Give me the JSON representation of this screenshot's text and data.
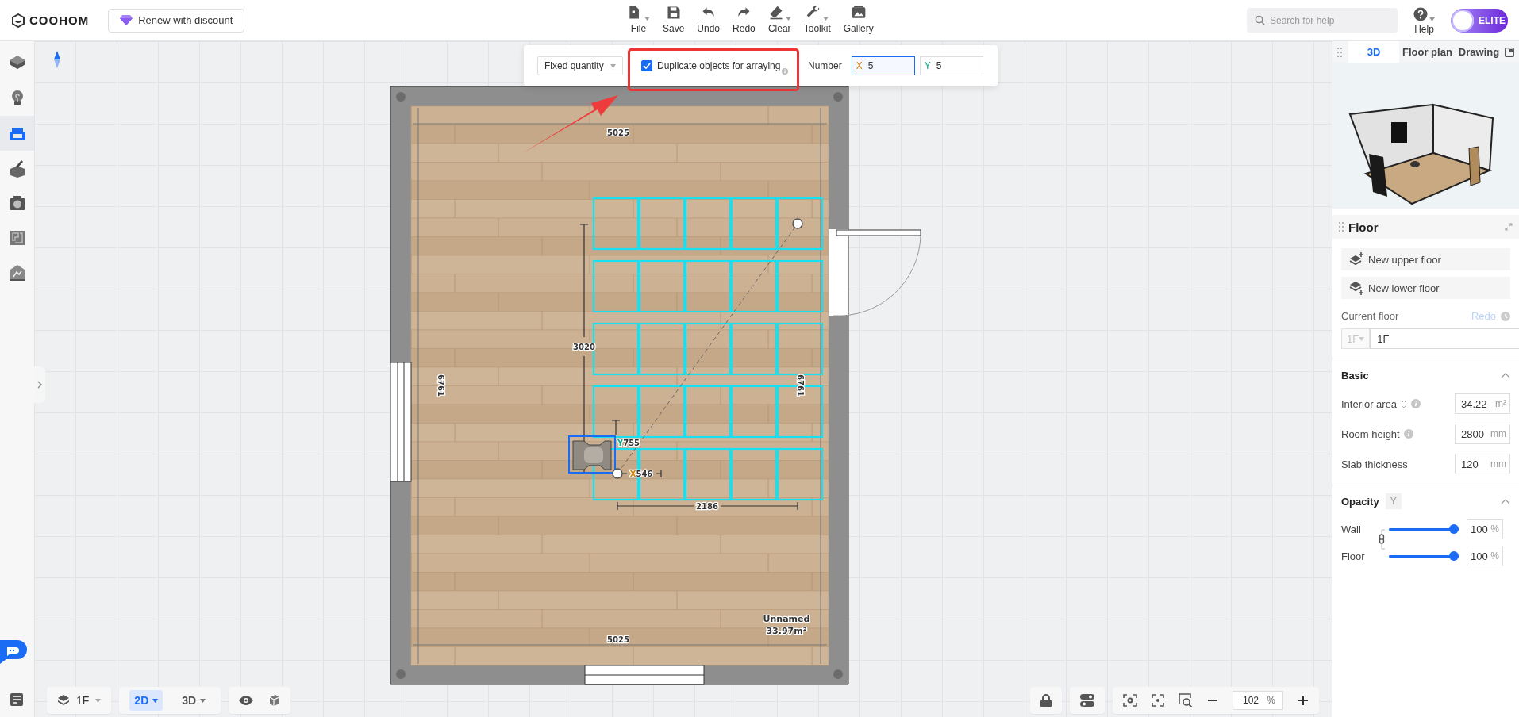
{
  "header": {
    "logo": "COOHOM",
    "promo": "Renew with discount",
    "tools": [
      {
        "kind": "file",
        "label": "File",
        "menu": true
      },
      {
        "kind": "save",
        "label": "Save",
        "menu": false
      },
      {
        "kind": "undo",
        "label": "Undo",
        "menu": false
      },
      {
        "kind": "redo",
        "label": "Redo",
        "menu": false
      },
      {
        "kind": "clear",
        "label": "Clear",
        "menu": true
      },
      {
        "kind": "toolkit",
        "label": "Toolkit",
        "menu": true
      },
      {
        "kind": "gallery",
        "label": "Gallery",
        "menu": false
      }
    ],
    "search": {
      "placeholder": "Search for help"
    },
    "help": {
      "label": "Help",
      "menu": true
    },
    "plan_badge": "ELITE"
  },
  "sidebar": {
    "items": [
      {
        "kind": "build",
        "selected": false
      },
      {
        "kind": "light",
        "selected": false
      },
      {
        "kind": "furniture",
        "selected": true
      },
      {
        "kind": "customize",
        "selected": false
      },
      {
        "kind": "render",
        "selected": false
      },
      {
        "kind": "layout",
        "selected": false
      },
      {
        "kind": "ai",
        "selected": false
      }
    ]
  },
  "array_toolbar": {
    "mode": "Fixed quantity",
    "duplicate": {
      "label": "Duplicate objects for arraying",
      "checked": true
    },
    "number_label": "Number",
    "x": {
      "axis": "X",
      "value": "5",
      "focused": true
    },
    "y": {
      "axis": "Y",
      "value": "5",
      "focused": false
    }
  },
  "plan": {
    "labels": [
      {
        "kind": "wall_top",
        "text": "5025"
      },
      {
        "kind": "wall_bottom",
        "text": "5025"
      },
      {
        "kind": "wall_left",
        "text": "6761"
      },
      {
        "kind": "wall_right",
        "text": "6761"
      },
      {
        "kind": "height",
        "text": "3020"
      },
      {
        "kind": "offset_x",
        "axis": "X",
        "text": "546"
      },
      {
        "kind": "offset_y",
        "axis": "Y",
        "text": "755"
      },
      {
        "kind": "span",
        "text": "2186"
      }
    ],
    "room": {
      "name": "Unnamed",
      "area": "33.97m²"
    }
  },
  "bottom_bar": {
    "floor": "1F",
    "view_modes": [
      {
        "label": "2D",
        "selected": true
      },
      {
        "label": "3D",
        "selected": false
      }
    ],
    "zoom": {
      "value": "102",
      "unit": "%"
    }
  },
  "right_panel": {
    "view_tabs": [
      {
        "label": "3D",
        "selected": true
      },
      {
        "label": "Floor plan",
        "selected": false
      },
      {
        "label": "Drawing",
        "selected": false
      }
    ],
    "floor": {
      "title": "Floor",
      "buttons": [
        {
          "kind": "upper",
          "label": "New upper floor"
        },
        {
          "kind": "lower",
          "label": "New lower floor"
        }
      ],
      "current_label": "Current floor",
      "redo": {
        "label": "Redo",
        "disabled": true
      },
      "floor_select": {
        "value": "1F",
        "disabled": true
      },
      "floor_name": "1F"
    },
    "basic": {
      "title": "Basic",
      "expanded": true,
      "fields": [
        {
          "label": "Interior area",
          "sortable": true,
          "info": true,
          "value": "34.22",
          "unit": "m²"
        },
        {
          "label": "Room height",
          "sortable": false,
          "info": true,
          "value": "2800",
          "unit": "mm"
        },
        {
          "label": "Slab thickness",
          "sortable": false,
          "info": false,
          "value": "120",
          "unit": "mm"
        }
      ]
    },
    "opacity": {
      "title": "Opacity",
      "tag": "Y",
      "expanded": true,
      "linked": true,
      "sliders": [
        {
          "label": "Wall",
          "level": 1.0,
          "value": "100",
          "unit": "%"
        },
        {
          "label": "Floor",
          "level": 1.0,
          "value": "100",
          "unit": "%"
        }
      ]
    }
  }
}
